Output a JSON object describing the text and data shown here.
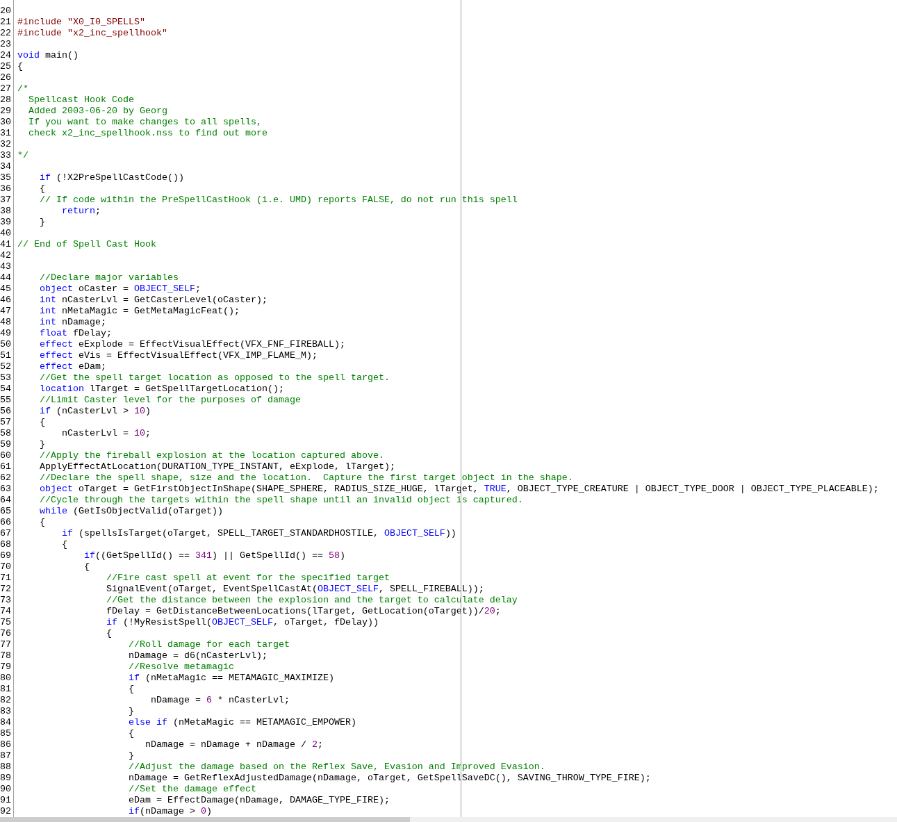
{
  "lines": [
    {
      "number": "20"
    },
    {
      "number": "21",
      "tokens": [
        {
          "kind": "preprocessor",
          "text": "#include \"X0_I0_SPELLS\""
        }
      ]
    },
    {
      "number": "22",
      "tokens": [
        {
          "kind": "preprocessor",
          "text": "#include \"x2_inc_spellhook\""
        }
      ]
    },
    {
      "number": "23"
    },
    {
      "number": "24",
      "tokens": [
        {
          "kind": "keyword",
          "text": "void"
        },
        {
          "kind": "plain",
          "text": " main()"
        }
      ]
    },
    {
      "number": "25",
      "tokens": [
        {
          "kind": "plain",
          "text": "{"
        }
      ]
    },
    {
      "number": "26"
    },
    {
      "number": "27",
      "tokens": [
        {
          "kind": "comment",
          "text": "/*"
        }
      ]
    },
    {
      "number": "28",
      "tokens": [
        {
          "kind": "comment",
          "text": "  Spellcast Hook Code"
        }
      ]
    },
    {
      "number": "29",
      "tokens": [
        {
          "kind": "comment",
          "text": "  Added 2003-06-20 by Georg"
        }
      ]
    },
    {
      "number": "30",
      "tokens": [
        {
          "kind": "comment",
          "text": "  If you want to make changes to all spells,"
        }
      ]
    },
    {
      "number": "31",
      "tokens": [
        {
          "kind": "comment",
          "text": "  check x2_inc_spellhook.nss to find out more"
        }
      ]
    },
    {
      "number": "32"
    },
    {
      "number": "33",
      "tokens": [
        {
          "kind": "comment",
          "text": "*/"
        }
      ]
    },
    {
      "number": "34"
    },
    {
      "number": "35",
      "tokens": [
        {
          "kind": "keyword",
          "text": "    if"
        },
        {
          "kind": "plain",
          "text": " (!X2PreSpellCastCode())"
        }
      ]
    },
    {
      "number": "36",
      "tokens": [
        {
          "kind": "plain",
          "text": "    {"
        }
      ]
    },
    {
      "number": "37",
      "tokens": [
        {
          "kind": "comment",
          "text": "    // If code within the PreSpellCastHook (i.e. UMD) reports FALSE, do not run this spell"
        }
      ]
    },
    {
      "number": "38",
      "tokens": [
        {
          "kind": "keyword",
          "text": "        return"
        },
        {
          "kind": "plain",
          "text": ";"
        }
      ]
    },
    {
      "number": "39",
      "tokens": [
        {
          "kind": "plain",
          "text": "    }"
        }
      ]
    },
    {
      "number": "40"
    },
    {
      "number": "41",
      "tokens": [
        {
          "kind": "comment",
          "text": "// End of Spell Cast Hook"
        }
      ]
    },
    {
      "number": "42"
    },
    {
      "number": "43"
    },
    {
      "number": "44",
      "tokens": [
        {
          "kind": "comment",
          "text": "    //Declare major variables"
        }
      ]
    },
    {
      "number": "45",
      "tokens": [
        {
          "kind": "keyword",
          "text": "    object"
        },
        {
          "kind": "plain",
          "text": " oCaster = "
        },
        {
          "kind": "constant",
          "text": "OBJECT_SELF"
        },
        {
          "kind": "plain",
          "text": ";"
        }
      ]
    },
    {
      "number": "46",
      "tokens": [
        {
          "kind": "keyword",
          "text": "    int"
        },
        {
          "kind": "plain",
          "text": " nCasterLvl = GetCasterLevel(oCaster);"
        }
      ]
    },
    {
      "number": "47",
      "tokens": [
        {
          "kind": "keyword",
          "text": "    int"
        },
        {
          "kind": "plain",
          "text": " nMetaMagic = GetMetaMagicFeat();"
        }
      ]
    },
    {
      "number": "48",
      "tokens": [
        {
          "kind": "keyword",
          "text": "    int"
        },
        {
          "kind": "plain",
          "text": " nDamage;"
        }
      ]
    },
    {
      "number": "49",
      "tokens": [
        {
          "kind": "keyword",
          "text": "    float"
        },
        {
          "kind": "plain",
          "text": " fDelay;"
        }
      ]
    },
    {
      "number": "50",
      "tokens": [
        {
          "kind": "keyword",
          "text": "    effect"
        },
        {
          "kind": "plain",
          "text": " eExplode = EffectVisualEffect(VFX_FNF_FIREBALL);"
        }
      ]
    },
    {
      "number": "51",
      "tokens": [
        {
          "kind": "keyword",
          "text": "    effect"
        },
        {
          "kind": "plain",
          "text": " eVis = EffectVisualEffect(VFX_IMP_FLAME_M);"
        }
      ]
    },
    {
      "number": "52",
      "tokens": [
        {
          "kind": "keyword",
          "text": "    effect"
        },
        {
          "kind": "plain",
          "text": " eDam;"
        }
      ]
    },
    {
      "number": "53",
      "tokens": [
        {
          "kind": "comment",
          "text": "    //Get the spell target location as opposed to the spell target."
        }
      ]
    },
    {
      "number": "54",
      "tokens": [
        {
          "kind": "keyword",
          "text": "    location"
        },
        {
          "kind": "plain",
          "text": " lTarget = GetSpellTargetLocation();"
        }
      ]
    },
    {
      "number": "55",
      "tokens": [
        {
          "kind": "comment",
          "text": "    //Limit Caster level for the purposes of damage"
        }
      ]
    },
    {
      "number": "56",
      "tokens": [
        {
          "kind": "keyword",
          "text": "    if"
        },
        {
          "kind": "plain",
          "text": " (nCasterLvl > "
        },
        {
          "kind": "number",
          "text": "10"
        },
        {
          "kind": "plain",
          "text": ")"
        }
      ]
    },
    {
      "number": "57",
      "tokens": [
        {
          "kind": "plain",
          "text": "    {"
        }
      ]
    },
    {
      "number": "58",
      "tokens": [
        {
          "kind": "plain",
          "text": "        nCasterLvl = "
        },
        {
          "kind": "number",
          "text": "10"
        },
        {
          "kind": "plain",
          "text": ";"
        }
      ]
    },
    {
      "number": "59",
      "tokens": [
        {
          "kind": "plain",
          "text": "    }"
        }
      ]
    },
    {
      "number": "60",
      "tokens": [
        {
          "kind": "comment",
          "text": "    //Apply the fireball explosion at the location captured above."
        }
      ]
    },
    {
      "number": "61",
      "tokens": [
        {
          "kind": "plain",
          "text": "    ApplyEffectAtLocation(DURATION_TYPE_INSTANT, eExplode, lTarget);"
        }
      ]
    },
    {
      "number": "62",
      "tokens": [
        {
          "kind": "comment",
          "text": "    //Declare the spell shape, size and the location.  Capture the first target object in the shape."
        }
      ]
    },
    {
      "number": "63",
      "tokens": [
        {
          "kind": "keyword",
          "text": "    object"
        },
        {
          "kind": "plain",
          "text": " oTarget = GetFirstObjectInShape(SHAPE_SPHERE, RADIUS_SIZE_HUGE, lTarget, "
        },
        {
          "kind": "constant",
          "text": "TRUE"
        },
        {
          "kind": "plain",
          "text": ", OBJECT_TYPE_CREATURE | OBJECT_TYPE_DOOR | OBJECT_TYPE_PLACEABLE);"
        }
      ]
    },
    {
      "number": "64",
      "tokens": [
        {
          "kind": "comment",
          "text": "    //Cycle through the targets within the spell shape until an invalid object is captured."
        }
      ]
    },
    {
      "number": "65",
      "tokens": [
        {
          "kind": "keyword",
          "text": "    while"
        },
        {
          "kind": "plain",
          "text": " (GetIsObjectValid(oTarget))"
        }
      ]
    },
    {
      "number": "66",
      "tokens": [
        {
          "kind": "plain",
          "text": "    {"
        }
      ]
    },
    {
      "number": "67",
      "tokens": [
        {
          "kind": "keyword",
          "text": "        if"
        },
        {
          "kind": "plain",
          "text": " (spellsIsTarget(oTarget, SPELL_TARGET_STANDARDHOSTILE, "
        },
        {
          "kind": "constant",
          "text": "OBJECT_SELF"
        },
        {
          "kind": "plain",
          "text": "))"
        }
      ]
    },
    {
      "number": "68",
      "tokens": [
        {
          "kind": "plain",
          "text": "        {"
        }
      ]
    },
    {
      "number": "69",
      "tokens": [
        {
          "kind": "keyword",
          "text": "            if"
        },
        {
          "kind": "plain",
          "text": "((GetSpellId() == "
        },
        {
          "kind": "number",
          "text": "341"
        },
        {
          "kind": "plain",
          "text": ") || GetSpellId() == "
        },
        {
          "kind": "number",
          "text": "58"
        },
        {
          "kind": "plain",
          "text": ")"
        }
      ]
    },
    {
      "number": "70",
      "tokens": [
        {
          "kind": "plain",
          "text": "            {"
        }
      ]
    },
    {
      "number": "71",
      "tokens": [
        {
          "kind": "comment",
          "text": "                //Fire cast spell at event for the specified target"
        }
      ]
    },
    {
      "number": "72",
      "tokens": [
        {
          "kind": "plain",
          "text": "                SignalEvent(oTarget, EventSpellCastAt("
        },
        {
          "kind": "constant",
          "text": "OBJECT_SELF"
        },
        {
          "kind": "plain",
          "text": ", SPELL_FIREBALL));"
        }
      ]
    },
    {
      "number": "73",
      "tokens": [
        {
          "kind": "comment",
          "text": "                //Get the distance between the explosion and the target to calculate delay"
        }
      ]
    },
    {
      "number": "74",
      "tokens": [
        {
          "kind": "plain",
          "text": "                fDelay = GetDistanceBetweenLocations(lTarget, GetLocation(oTarget))/"
        },
        {
          "kind": "number",
          "text": "20"
        },
        {
          "kind": "plain",
          "text": ";"
        }
      ]
    },
    {
      "number": "75",
      "tokens": [
        {
          "kind": "keyword",
          "text": "                if"
        },
        {
          "kind": "plain",
          "text": " (!MyResistSpell("
        },
        {
          "kind": "constant",
          "text": "OBJECT_SELF"
        },
        {
          "kind": "plain",
          "text": ", oTarget, fDelay))"
        }
      ]
    },
    {
      "number": "76",
      "tokens": [
        {
          "kind": "plain",
          "text": "                {"
        }
      ]
    },
    {
      "number": "77",
      "tokens": [
        {
          "kind": "comment",
          "text": "                    //Roll damage for each target"
        }
      ]
    },
    {
      "number": "78",
      "tokens": [
        {
          "kind": "plain",
          "text": "                    nDamage = d6(nCasterLvl);"
        }
      ]
    },
    {
      "number": "79",
      "tokens": [
        {
          "kind": "comment",
          "text": "                    //Resolve metamagic"
        }
      ]
    },
    {
      "number": "80",
      "tokens": [
        {
          "kind": "keyword",
          "text": "                    if"
        },
        {
          "kind": "plain",
          "text": " (nMetaMagic == METAMAGIC_MAXIMIZE)"
        }
      ]
    },
    {
      "number": "81",
      "tokens": [
        {
          "kind": "plain",
          "text": "                    {"
        }
      ]
    },
    {
      "number": "82",
      "tokens": [
        {
          "kind": "plain",
          "text": "                        nDamage = "
        },
        {
          "kind": "number",
          "text": "6"
        },
        {
          "kind": "plain",
          "text": " * nCasterLvl;"
        }
      ]
    },
    {
      "number": "83",
      "tokens": [
        {
          "kind": "plain",
          "text": "                    }"
        }
      ]
    },
    {
      "number": "84",
      "tokens": [
        {
          "kind": "keyword",
          "text": "                    else if"
        },
        {
          "kind": "plain",
          "text": " (nMetaMagic == METAMAGIC_EMPOWER)"
        }
      ]
    },
    {
      "number": "85",
      "tokens": [
        {
          "kind": "plain",
          "text": "                    {"
        }
      ]
    },
    {
      "number": "86",
      "tokens": [
        {
          "kind": "plain",
          "text": "                       nDamage = nDamage + nDamage / "
        },
        {
          "kind": "number",
          "text": "2"
        },
        {
          "kind": "plain",
          "text": ";"
        }
      ]
    },
    {
      "number": "87",
      "tokens": [
        {
          "kind": "plain",
          "text": "                    }"
        }
      ]
    },
    {
      "number": "88",
      "tokens": [
        {
          "kind": "comment",
          "text": "                    //Adjust the damage based on the Reflex Save, Evasion and Improved Evasion."
        }
      ]
    },
    {
      "number": "89",
      "tokens": [
        {
          "kind": "plain",
          "text": "                    nDamage = GetReflexAdjustedDamage(nDamage, oTarget, GetSpellSaveDC(), SAVING_THROW_TYPE_FIRE);"
        }
      ]
    },
    {
      "number": "90",
      "tokens": [
        {
          "kind": "comment",
          "text": "                    //Set the damage effect"
        }
      ]
    },
    {
      "number": "91",
      "tokens": [
        {
          "kind": "plain",
          "text": "                    eDam = EffectDamage(nDamage, DAMAGE_TYPE_FIRE);"
        }
      ]
    },
    {
      "number": "92",
      "tokens": [
        {
          "kind": "keyword",
          "text": "                    if"
        },
        {
          "kind": "plain",
          "text": "(nDamage > "
        },
        {
          "kind": "number",
          "text": "0"
        },
        {
          "kind": "plain",
          "text": ")"
        }
      ]
    }
  ]
}
